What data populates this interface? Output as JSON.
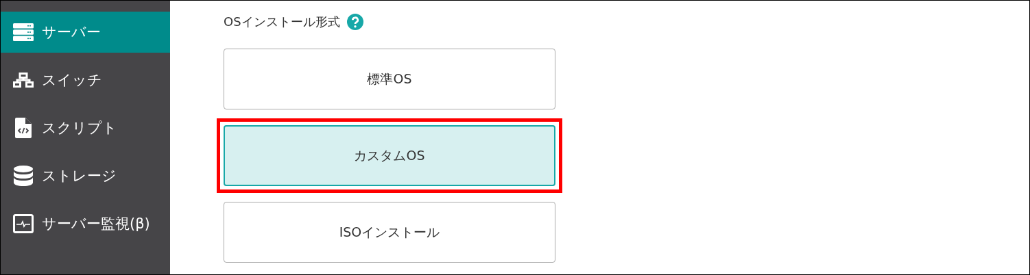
{
  "sidebar": {
    "items": [
      {
        "label": "サーバー",
        "selected": true
      },
      {
        "label": "スイッチ",
        "selected": false
      },
      {
        "label": "スクリプト",
        "selected": false
      },
      {
        "label": "ストレージ",
        "selected": false
      },
      {
        "label": "サーバー監視(β)",
        "selected": false
      }
    ]
  },
  "install_type": {
    "label": "OSインストール形式",
    "options": [
      {
        "label": "標準OS",
        "selected": false,
        "highlighted": false
      },
      {
        "label": "カスタムOS",
        "selected": true,
        "highlighted": true
      },
      {
        "label": "ISOインストール",
        "selected": false,
        "highlighted": false
      }
    ]
  }
}
